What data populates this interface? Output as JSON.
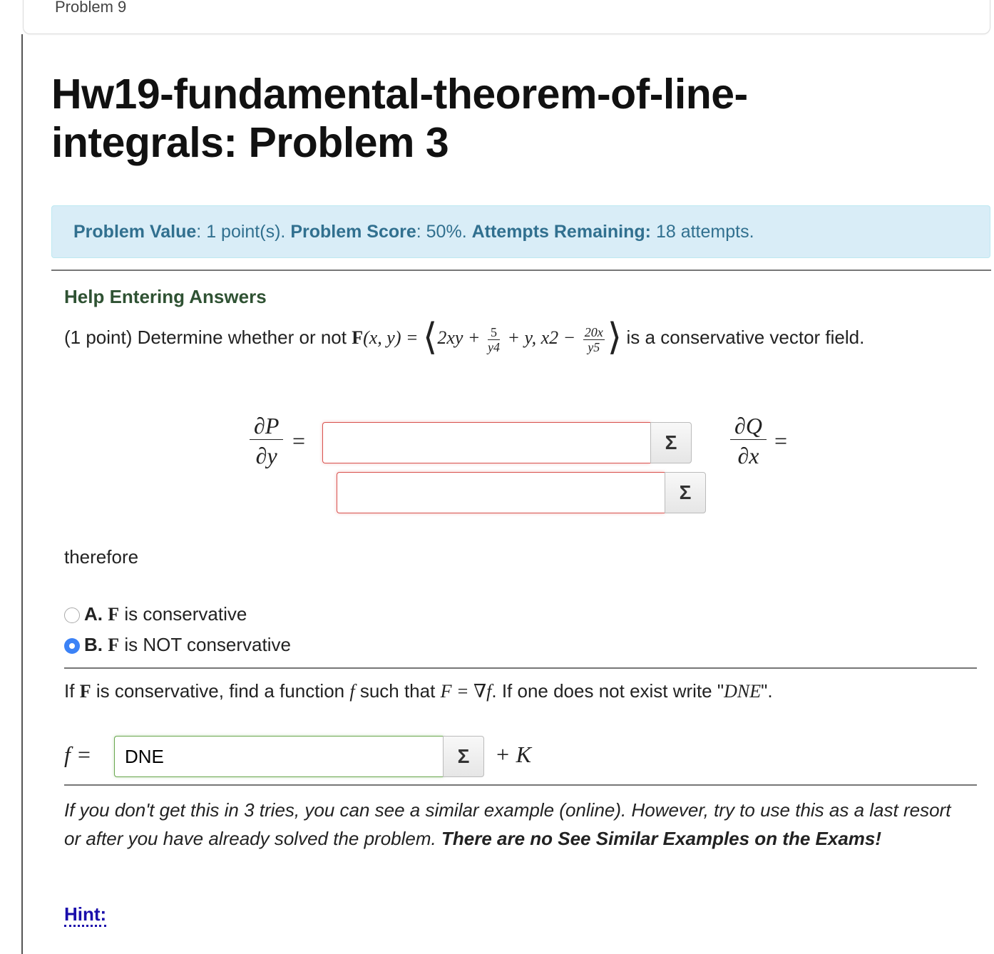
{
  "previous_problem": {
    "title": "Problem 9"
  },
  "page_title": "Hw19-fundamental-theorem-of-line-integrals: Problem 3",
  "score_box": {
    "value_label": "Problem Value",
    "value_text": ": 1 point(s).",
    "score_label": "Problem Score",
    "score_text": ": 50%.",
    "attempts_label": "Attempts Remaining:",
    "attempts_text": "18 attempts."
  },
  "help_link": "Help Entering Answers",
  "statement": {
    "intro": "(1 point) Determine whether or not",
    "F": "F",
    "args": "(x, y) =",
    "term1": "2xy +",
    "frac1_num": "5",
    "frac1_den": "y4",
    "term2": "+ y, x2 −",
    "frac2_num": "20x",
    "frac2_den": "y5",
    "outro": "is a conservative vector field."
  },
  "partials": {
    "dP_num": "∂P",
    "dP_den": "∂y",
    "dQ_num": "∂Q",
    "dQ_den": "∂x",
    "equals": "="
  },
  "inputs": {
    "dP_value": "",
    "dQ_value": "",
    "f_value": "DNE",
    "sigma": "Σ"
  },
  "therefore": "therefore",
  "choices": [
    {
      "letter": "A.",
      "F": "F",
      "text": "is conservative",
      "selected": false
    },
    {
      "letter": "B.",
      "F": "F",
      "text": "is NOT conservative",
      "selected": true
    }
  ],
  "find": {
    "prefix": "If",
    "F": "F",
    "mid1": "is conservative, find a function",
    "f": "f",
    "mid2": "such that",
    "eq": "F = ∇f",
    "suffix": ". If one does not exist write \"",
    "dne": "DNE",
    "end": "\"."
  },
  "f_label": "f =",
  "plus_k": "+ K",
  "note": {
    "italic": "If you don't get this in 3 tries, you can see a similar example (online). However, try to use this as a last resort or after you have already solved the problem.",
    "bold": "There are no See Similar Examples on the Exams!"
  },
  "hint_link": "Hint:"
}
